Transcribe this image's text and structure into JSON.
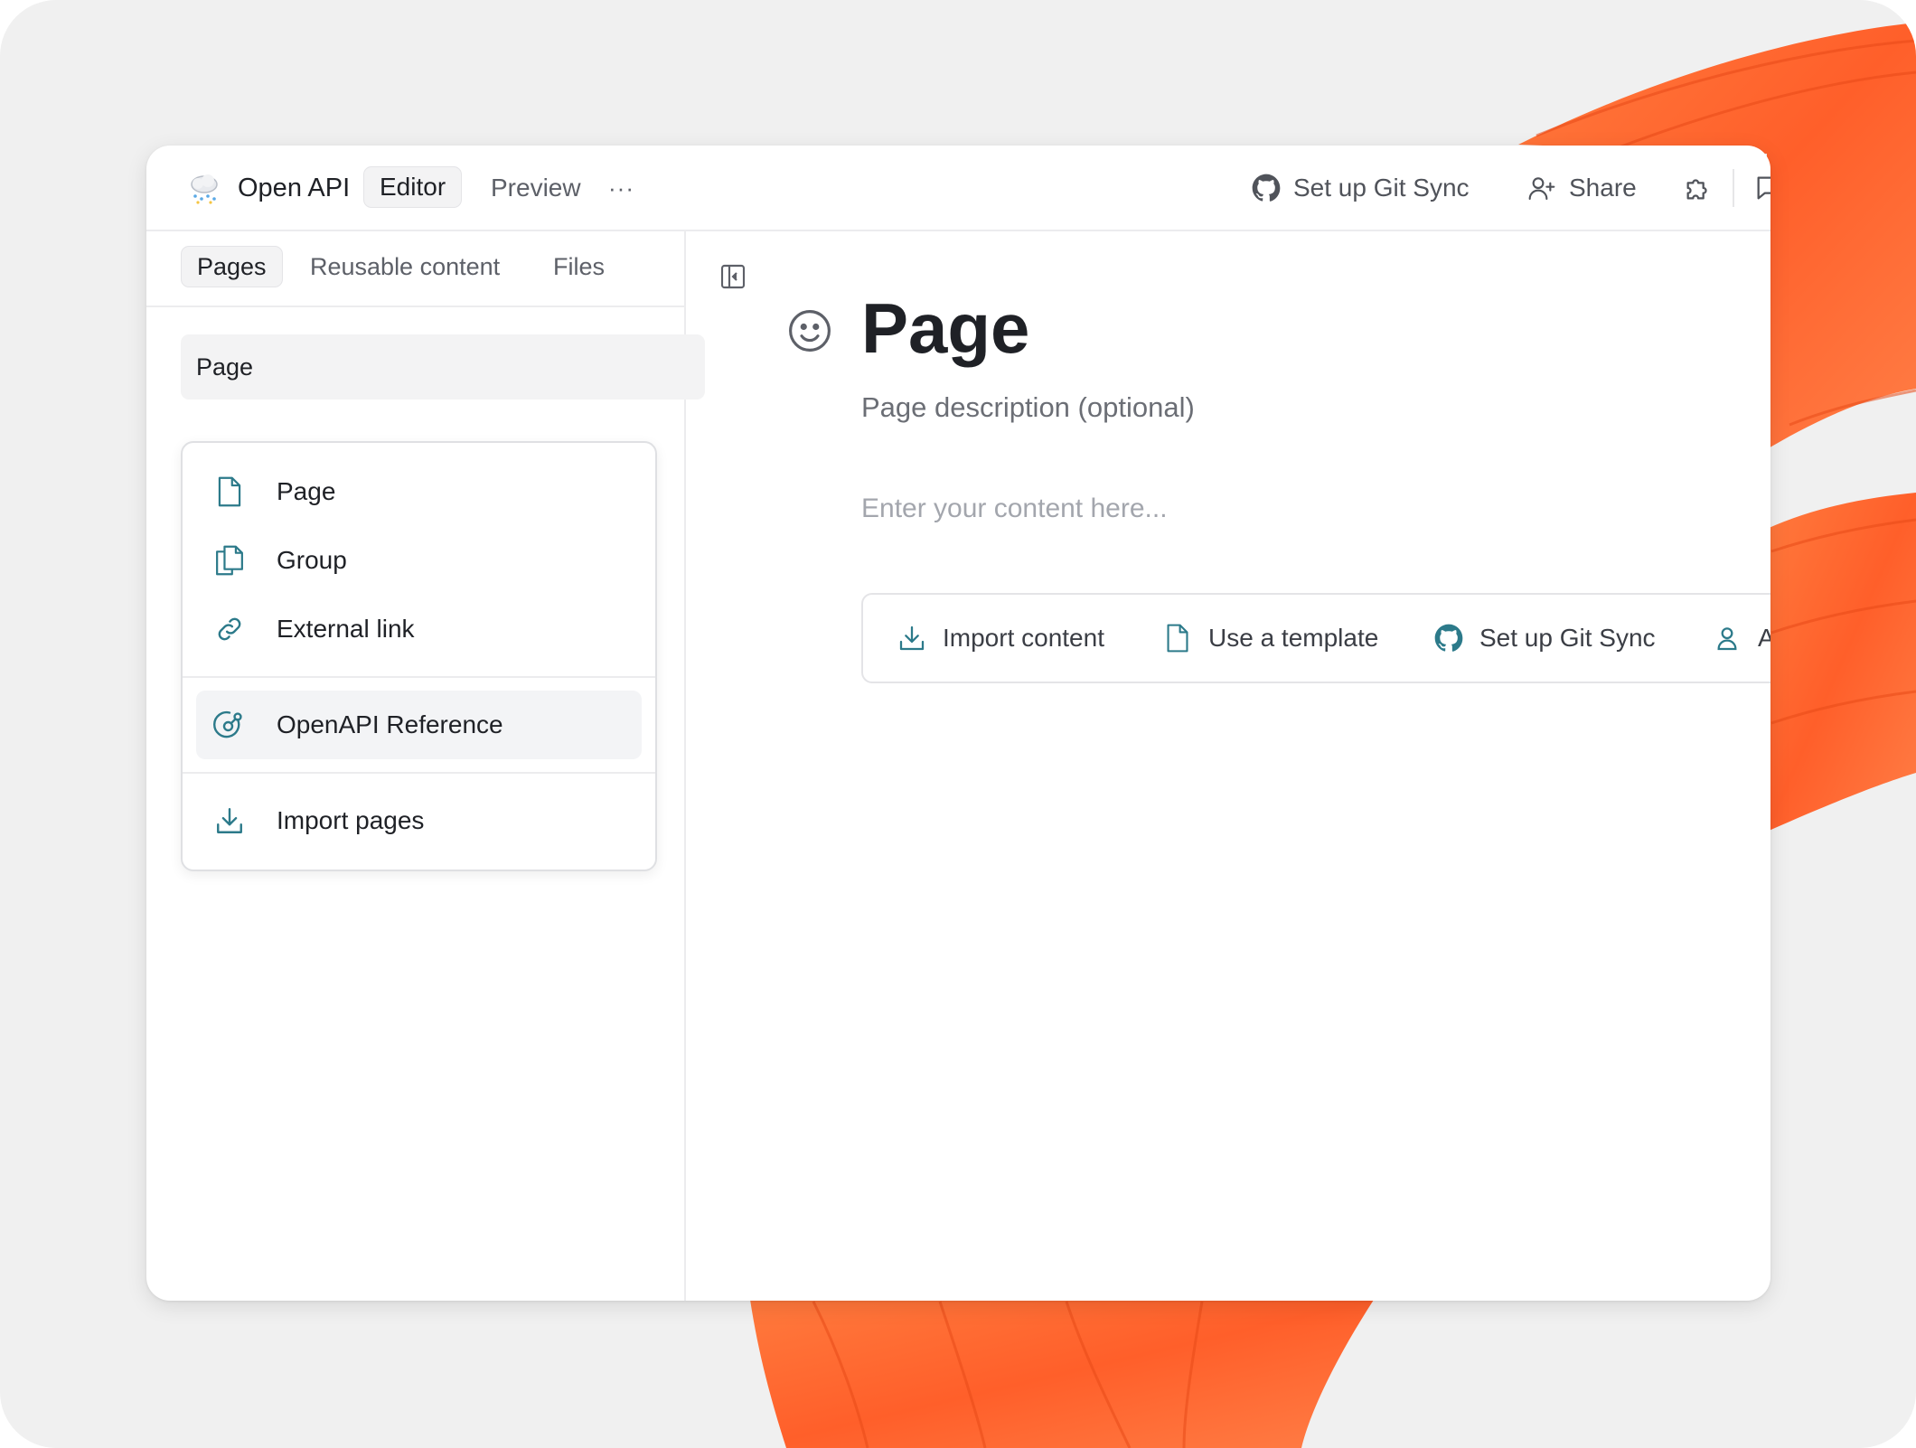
{
  "colors": {
    "accent": "#2c7a8a",
    "background": "#f0f0f0",
    "deco": "#ff6a2f"
  },
  "topbar": {
    "logo_icon": "cloud-rain-icon",
    "site_name": "Open API",
    "editor_label": "Editor",
    "preview_label": "Preview",
    "more_label": "···",
    "git_sync_label": "Set up Git Sync",
    "share_label": "Share"
  },
  "sidebar": {
    "tabs": [
      {
        "label": "Pages",
        "active": true
      },
      {
        "label": "Reusable content",
        "active": false
      },
      {
        "label": "Files",
        "active": false
      }
    ],
    "page_row_label": "Page",
    "menu": {
      "items": [
        {
          "icon": "file-icon",
          "label": "Page"
        },
        {
          "icon": "files-icon",
          "label": "Group"
        },
        {
          "icon": "link-icon",
          "label": "External link"
        },
        {
          "icon": "openapi-icon",
          "label": "OpenAPI Reference",
          "highlighted": true
        },
        {
          "icon": "download-icon",
          "label": "Import pages"
        }
      ]
    }
  },
  "main": {
    "title": "Page",
    "description_placeholder": "Page description (optional)",
    "content_placeholder": "Enter your content here...",
    "actions": [
      {
        "icon": "download-icon",
        "label": "Import content"
      },
      {
        "icon": "file-icon",
        "label": "Use a template"
      },
      {
        "icon": "github-icon",
        "label": "Set up Git Sync"
      },
      {
        "icon": "user-icon",
        "label": "A"
      }
    ]
  }
}
